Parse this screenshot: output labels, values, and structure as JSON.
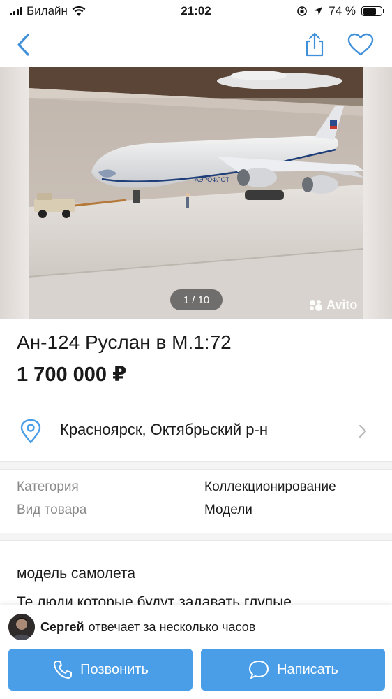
{
  "status_bar": {
    "carrier": "Билайн",
    "time": "21:02",
    "battery": "74 %",
    "battery_level": 0.74
  },
  "nav": {
    "back_icon": "chevron-left-icon",
    "share_icon": "share-icon",
    "favorite_icon": "heart-icon"
  },
  "gallery": {
    "counter": "1 / 10",
    "watermark": "Avito"
  },
  "listing": {
    "title": "Ан-124 Руслан в М.1:72",
    "price": "1 700 000 ₽",
    "location": "Красноярск, Октябрьский р-н"
  },
  "params": [
    {
      "label": "Категория",
      "value": "Коллекционирование"
    },
    {
      "label": "Вид товара",
      "value": "Модели"
    }
  ],
  "description": {
    "line1": "модель самолета",
    "line2": "Те люди которые будут задавать глупые"
  },
  "seller": {
    "name": "Сергей",
    "status": "отвечает за несколько часов"
  },
  "actions": {
    "call_label": "Позвонить",
    "message_label": "Написать"
  },
  "colors": {
    "accent": "#4a9ee8",
    "nav_icon": "#3f8fd9"
  }
}
